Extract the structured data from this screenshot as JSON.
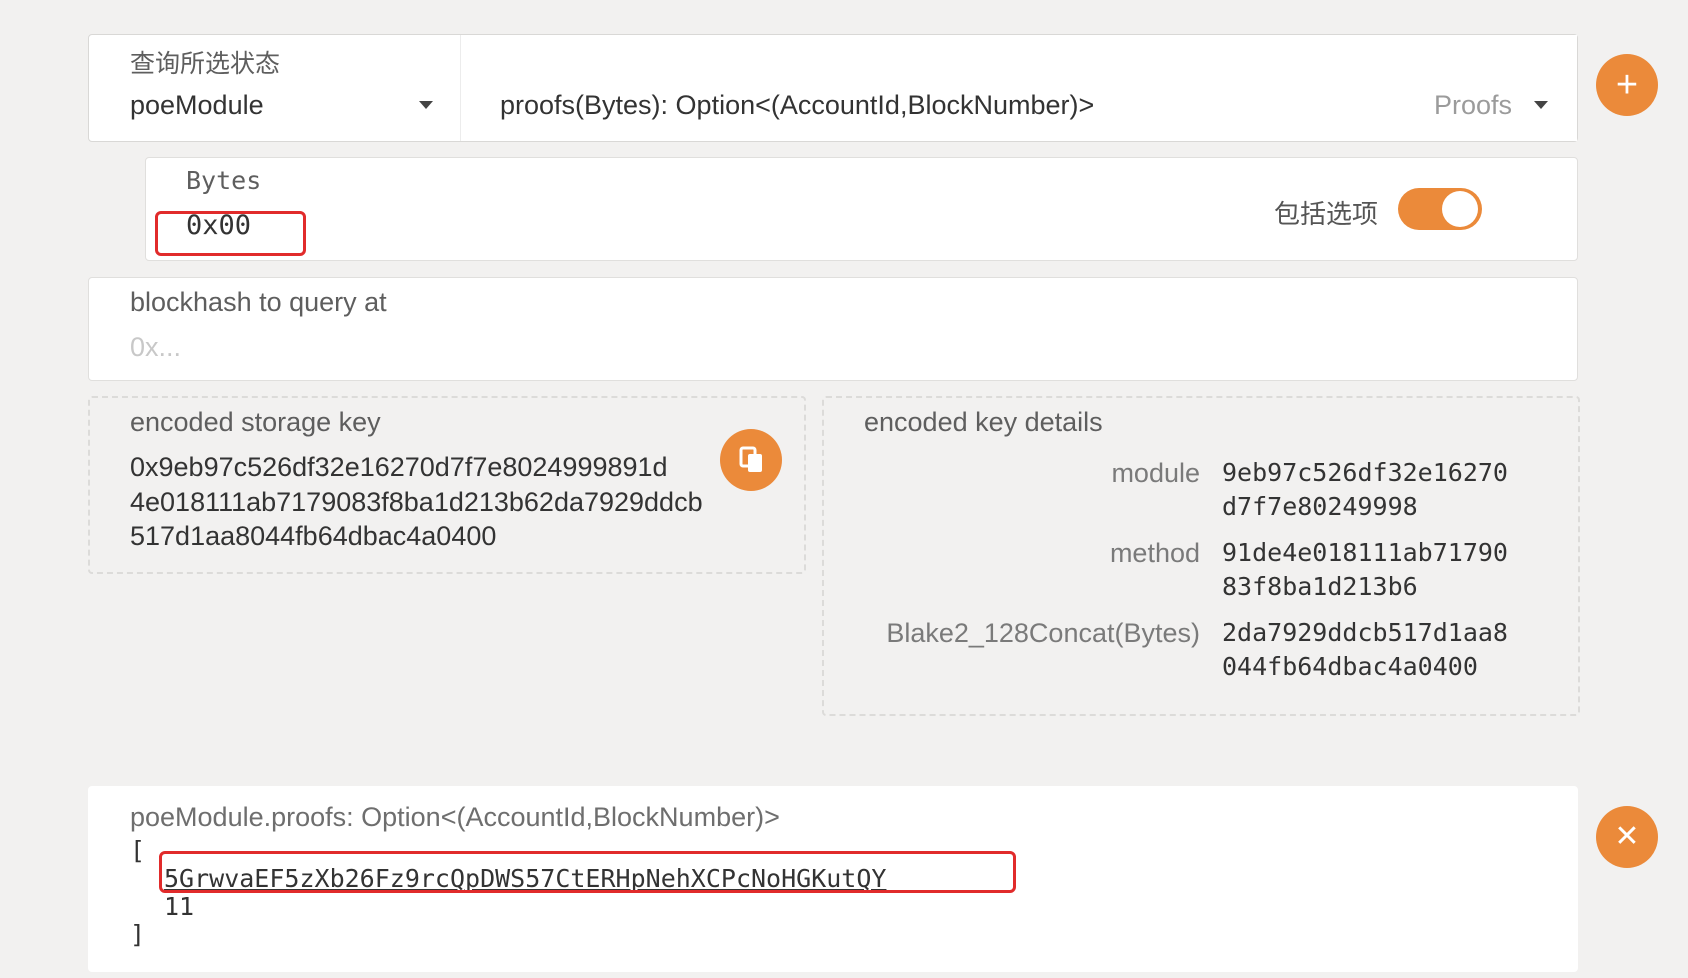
{
  "query": {
    "module_label": "查询所选状态",
    "module_value": "poeModule",
    "method_value": "proofs(Bytes): Option<(AccountId,BlockNumber)>",
    "method_section": "Proofs"
  },
  "params": {
    "bytes_label": "Bytes",
    "bytes_value": "0x00",
    "toggle_label": "包括选项",
    "toggle_on": true
  },
  "blockhash": {
    "label": "blockhash to query at",
    "placeholder": "0x..."
  },
  "storage_key": {
    "label": "encoded storage key",
    "lines": [
      "0x9eb97c526df32e16270d7f7e8024999891d",
      "4e018111ab7179083f8ba1d213b62da7929ddcb",
      "517d1aa8044fb64dbac4a0400"
    ]
  },
  "key_details": {
    "title": "encoded key details",
    "rows": [
      {
        "label": "module",
        "lines": [
          "9eb97c526df32e16270",
          "d7f7e80249998"
        ]
      },
      {
        "label": "method",
        "lines": [
          "91de4e018111ab71790",
          "83f8ba1d213b6"
        ]
      },
      {
        "label": "Blake2_128Concat(Bytes)",
        "lines": [
          "2da7929ddcb517d1aa8",
          "044fb64dbac4a0400"
        ]
      }
    ]
  },
  "result": {
    "title": "poeModule.proofs: Option<(AccountId,BlockNumber)>",
    "open": "[",
    "account": "5GrwvaEF5zXb26Fz9rcQpDWS57CtERHpNehXCPcNoHGKutQY",
    "block": "11",
    "close": "]"
  },
  "colors": {
    "accent": "#eb8a3a",
    "highlight": "#e12b2b",
    "background": "#f2f1f0"
  },
  "icons": {
    "add": "plus-icon",
    "copy": "copy-icon",
    "close": "close-icon",
    "dropdown": "chevron-down-icon"
  }
}
